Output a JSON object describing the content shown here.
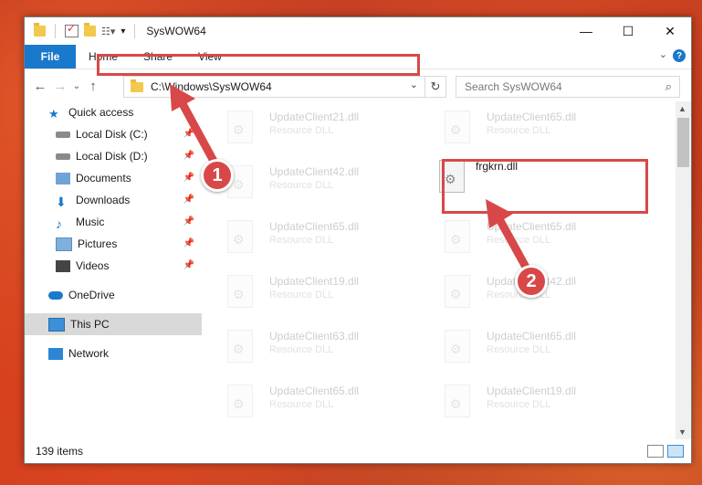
{
  "window": {
    "title": "SysWOW64",
    "controls": [
      "—",
      "☐",
      "✕"
    ]
  },
  "ribbon": {
    "file": "File",
    "tabs": [
      "Home",
      "Share",
      "View"
    ],
    "help": "?"
  },
  "address": {
    "path": "C:\\Windows\\SysWOW64"
  },
  "search": {
    "placeholder": "Search SysWOW64"
  },
  "sidebar": {
    "items": [
      {
        "label": "Quick access",
        "icon": "star-icon"
      },
      {
        "label": "Local Disk (C:)",
        "icon": "disk-icon",
        "pinned": true
      },
      {
        "label": "Local Disk (D:)",
        "icon": "disk-icon",
        "pinned": true
      },
      {
        "label": "Documents",
        "icon": "documents-icon",
        "pinned": true
      },
      {
        "label": "Downloads",
        "icon": "downloads-icon",
        "pinned": true
      },
      {
        "label": "Music",
        "icon": "music-icon",
        "pinned": true
      },
      {
        "label": "Pictures",
        "icon": "pictures-icon",
        "pinned": true
      },
      {
        "label": "Videos",
        "icon": "videos-icon",
        "pinned": true
      },
      {
        "label": "OneDrive",
        "icon": "onedrive-icon"
      },
      {
        "label": "This PC",
        "icon": "this-pc-icon",
        "selected": true
      },
      {
        "label": "Network",
        "icon": "network-icon"
      }
    ]
  },
  "files": [
    {
      "name": "UpdateClient21.dll",
      "type": "Resource DLL"
    },
    {
      "name": "UpdateClient65.dll",
      "type": "Resource DLL"
    },
    {
      "name": "UpdateClient42.dll",
      "type": "Resource DLL"
    },
    {
      "name": "frgkrn.dll",
      "type": ""
    },
    {
      "name": "UpdateClient65.dll",
      "type": "Resource DLL"
    },
    {
      "name": "UpdateClient65.dll",
      "type": "Resource DLL"
    },
    {
      "name": "UpdateClient19.dll",
      "type": "Resource DLL"
    },
    {
      "name": "UpdateClient42.dll",
      "type": "Resource DLL"
    },
    {
      "name": "UpdateClient63.dll",
      "type": "Resource DLL"
    },
    {
      "name": "UpdateClient65.dll",
      "type": "Resource DLL"
    },
    {
      "name": "UpdateClient65.dll",
      "type": "Resource DLL"
    },
    {
      "name": "UpdateClient19.dll",
      "type": "Resource DLL"
    }
  ],
  "status": {
    "count": "139 items"
  },
  "annotations": {
    "step1": "1",
    "step2": "2",
    "color": "#d84848"
  }
}
